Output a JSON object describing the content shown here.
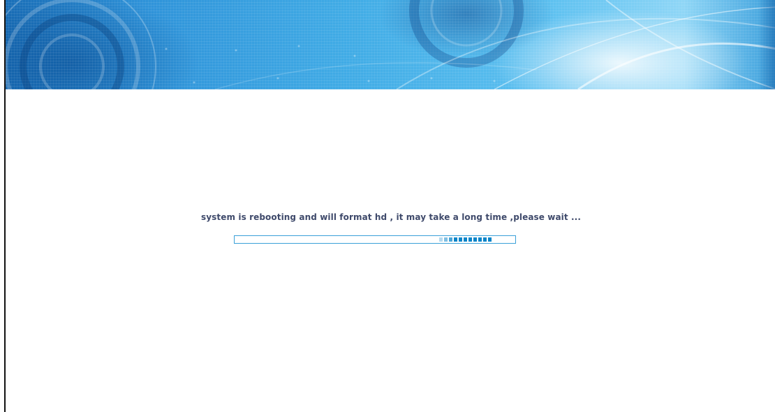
{
  "status": {
    "message": "system is rebooting and will format hd , it may take a long time ,please wait ..."
  },
  "progress": {
    "indicator": "indeterminate",
    "block_count": 11,
    "accent_color": "#0a85c9",
    "track_border_color": "#3aa0d8"
  },
  "banner": {
    "theme": "blue-abstract-circles"
  }
}
